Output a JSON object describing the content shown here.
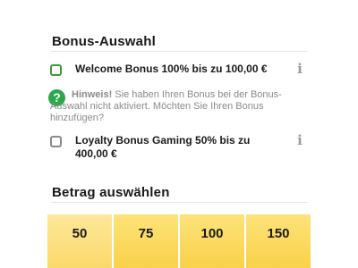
{
  "bonus_section": {
    "title": "Bonus-Auswahl",
    "options": [
      {
        "label": "Welcome Bonus 100% bis zu 100,00 €",
        "checked": false,
        "checkbox_color": "#3a9b3a",
        "info_icon": "info-icon"
      },
      {
        "label_line1": "Loyalty Bonus Gaming 50% bis zu",
        "label_line2": "400,00 €",
        "checked": false,
        "checkbox_color": "#8a8a8a",
        "info_icon": "info-icon"
      }
    ],
    "hint": {
      "icon": "question-icon",
      "icon_glyph": "?",
      "icon_color": "#2aa84a",
      "prefix": "Hinweis!",
      "text": " Sie haben Ihren Bonus bei der Bonus-Auswahl nicht aktiviert. Möchten Sie Ihren Bonus hinzufügen?"
    },
    "info_glyph": "i"
  },
  "amount_section": {
    "title": "Betrag auswählen",
    "amounts": [
      "50",
      "75",
      "100",
      "150"
    ],
    "button_color": "#fad14a"
  }
}
